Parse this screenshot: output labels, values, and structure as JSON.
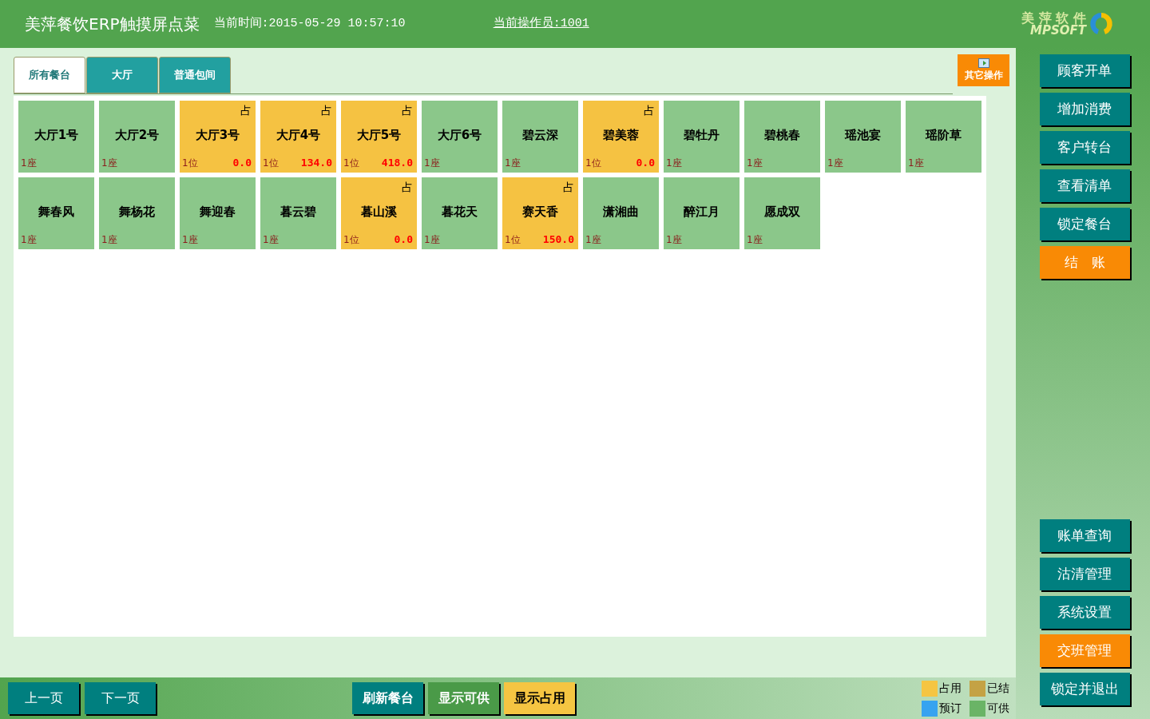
{
  "header": {
    "title": "美萍餐饮ERP触摸屏点菜",
    "time": "当前时间:2015-05-29 10:57:10",
    "operator": "当前操作员:1001",
    "logo_cn": "美 萍 软 件",
    "logo_en": "MPSOFT"
  },
  "tabs": [
    {
      "label": "所有餐台",
      "selected": true
    },
    {
      "label": "大厅",
      "selected": false
    },
    {
      "label": "普通包间",
      "selected": false
    }
  ],
  "other_button": "其它操作",
  "tables": [
    {
      "name": "大厅1号",
      "kind": "available",
      "seat": "1座"
    },
    {
      "name": "大厅2号",
      "kind": "available",
      "seat": "1座"
    },
    {
      "name": "大厅3号",
      "kind": "occupied",
      "mark": "占",
      "seat": "1位",
      "amount": "0.0"
    },
    {
      "name": "大厅4号",
      "kind": "occupied",
      "mark": "占",
      "seat": "1位",
      "amount": "134.0"
    },
    {
      "name": "大厅5号",
      "kind": "occupied",
      "mark": "占",
      "seat": "1位",
      "amount": "418.0"
    },
    {
      "name": "大厅6号",
      "kind": "available",
      "seat": "1座"
    },
    {
      "name": "碧云深",
      "kind": "available",
      "seat": "1座"
    },
    {
      "name": "碧美蓉",
      "kind": "occupied",
      "mark": "占",
      "seat": "1位",
      "amount": "0.0"
    },
    {
      "name": "碧牡丹",
      "kind": "available",
      "seat": "1座"
    },
    {
      "name": "碧桃春",
      "kind": "available",
      "seat": "1座"
    },
    {
      "name": "瑶池宴",
      "kind": "available",
      "seat": "1座"
    },
    {
      "name": "瑶阶草",
      "kind": "available",
      "seat": "1座"
    },
    {
      "name": "舞春风",
      "kind": "available",
      "seat": "1座"
    },
    {
      "name": "舞杨花",
      "kind": "available",
      "seat": "1座"
    },
    {
      "name": "舞迎春",
      "kind": "available",
      "seat": "1座"
    },
    {
      "name": "暮云碧",
      "kind": "available",
      "seat": "1座"
    },
    {
      "name": "暮山溪",
      "kind": "occupied",
      "mark": "占",
      "seat": "1位",
      "amount": "0.0"
    },
    {
      "name": "暮花天",
      "kind": "available",
      "seat": "1座"
    },
    {
      "name": "赛天香",
      "kind": "occupied",
      "mark": "占",
      "seat": "1位",
      "amount": "150.0"
    },
    {
      "name": "潇湘曲",
      "kind": "available",
      "seat": "1座"
    },
    {
      "name": "醉江月",
      "kind": "available",
      "seat": "1座"
    },
    {
      "name": "愿成双",
      "kind": "available",
      "seat": "1座"
    }
  ],
  "side_top": [
    {
      "label": "顾客开单",
      "kind": "teal"
    },
    {
      "label": "增加消费",
      "kind": "teal"
    },
    {
      "label": "客户转台",
      "kind": "teal"
    },
    {
      "label": "查看清单",
      "kind": "teal"
    },
    {
      "label": "锁定餐台",
      "kind": "teal"
    },
    {
      "label": "结　账",
      "kind": "orange"
    }
  ],
  "side_bottom": [
    {
      "label": "账单查询",
      "kind": "teal"
    },
    {
      "label": "沽清管理",
      "kind": "teal"
    },
    {
      "label": "系统设置",
      "kind": "teal"
    },
    {
      "label": "交班管理",
      "kind": "orange"
    },
    {
      "label": "锁定并退出",
      "kind": "teal"
    }
  ],
  "pager": [
    {
      "label": "上一页",
      "kind": "teal"
    },
    {
      "label": "下一页",
      "kind": "teal"
    }
  ],
  "filters": [
    {
      "label": "刷新餐台",
      "kind": "teal"
    },
    {
      "label": "显示可供",
      "kind": "green"
    },
    {
      "label": "显示占用",
      "kind": "yellow"
    }
  ],
  "legend": [
    {
      "label": "占用",
      "color": "#f5c542"
    },
    {
      "label": "已结",
      "color": "#c4a244"
    },
    {
      "label": "预订",
      "color": "#36a3f0"
    },
    {
      "label": "可供",
      "color": "#6ab466"
    }
  ]
}
